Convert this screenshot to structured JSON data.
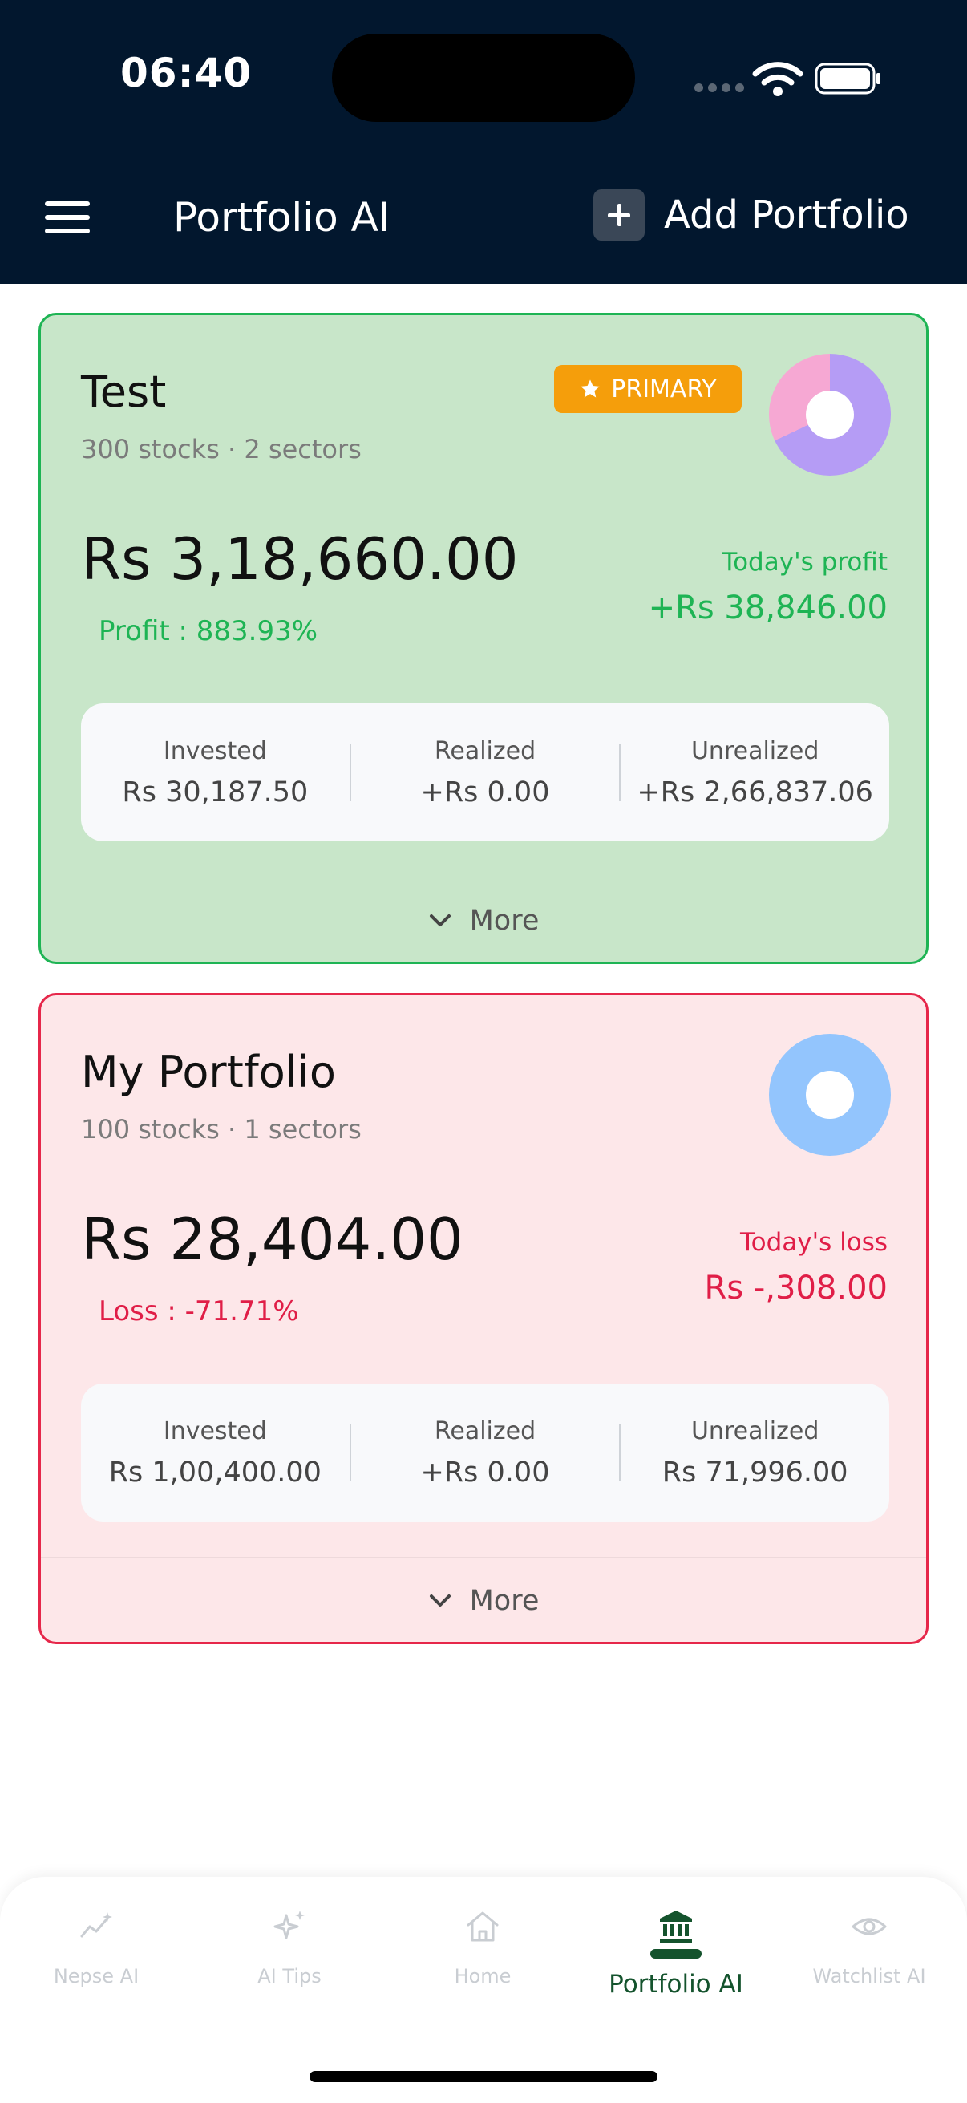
{
  "status_bar": {
    "time": "06:40"
  },
  "header": {
    "title": "Portfolio AI",
    "add_button_label": "Add Portfolio"
  },
  "portfolios": [
    {
      "name": "Test",
      "summary": "300 stocks · 2 sectors",
      "badge": "PRIMARY",
      "value": "Rs 3,18,660.00",
      "percent_text": "Profit : 883.93%",
      "today_label": "Today's profit",
      "today_value": "+Rs 38,846.00",
      "stats": {
        "invested_label": "Invested",
        "invested_value": "Rs 30,187.50",
        "realized_label": "Realized",
        "realized_value": "+Rs 0.00",
        "unrealized_label": "Unrealized",
        "unrealized_value": "+Rs 2,66,837.06"
      },
      "more_label": "More",
      "sector_chart": {
        "segments": [
          {
            "color": "#b59cf5",
            "fraction": 0.68
          },
          {
            "color": "#f6a8d3",
            "fraction": 0.32
          }
        ]
      }
    },
    {
      "name": "My Portfolio",
      "summary": "100 stocks · 1 sectors",
      "value": "Rs 28,404.00",
      "percent_text": "Loss : -71.71%",
      "today_label": "Today's loss",
      "today_value": "Rs -,308.00",
      "stats": {
        "invested_label": "Invested",
        "invested_value": "Rs 1,00,400.00",
        "realized_label": "Realized",
        "realized_value": "+Rs 0.00",
        "unrealized_label": "Unrealized",
        "unrealized_value": "Rs 71,996.00"
      },
      "more_label": "More",
      "sector_chart": {
        "segments": [
          {
            "color": "#93c5fd",
            "fraction": 1.0
          }
        ]
      }
    }
  ],
  "bottom_nav": [
    {
      "label": "Nepse AI",
      "icon": "chart-sparkle-icon",
      "active": false
    },
    {
      "label": "AI Tips",
      "icon": "sparkles-icon",
      "active": false
    },
    {
      "label": "Home",
      "icon": "home-icon",
      "active": false
    },
    {
      "label": "Portfolio AI",
      "icon": "bank-icon",
      "active": true
    },
    {
      "label": "Watchlist AI",
      "icon": "eye-icon",
      "active": false
    }
  ],
  "colors": {
    "header_bg": "#02172e",
    "profit_green": "#1eb454",
    "loss_red": "#e01e47",
    "badge_orange": "#f59e0b",
    "nav_active": "#14532d"
  }
}
